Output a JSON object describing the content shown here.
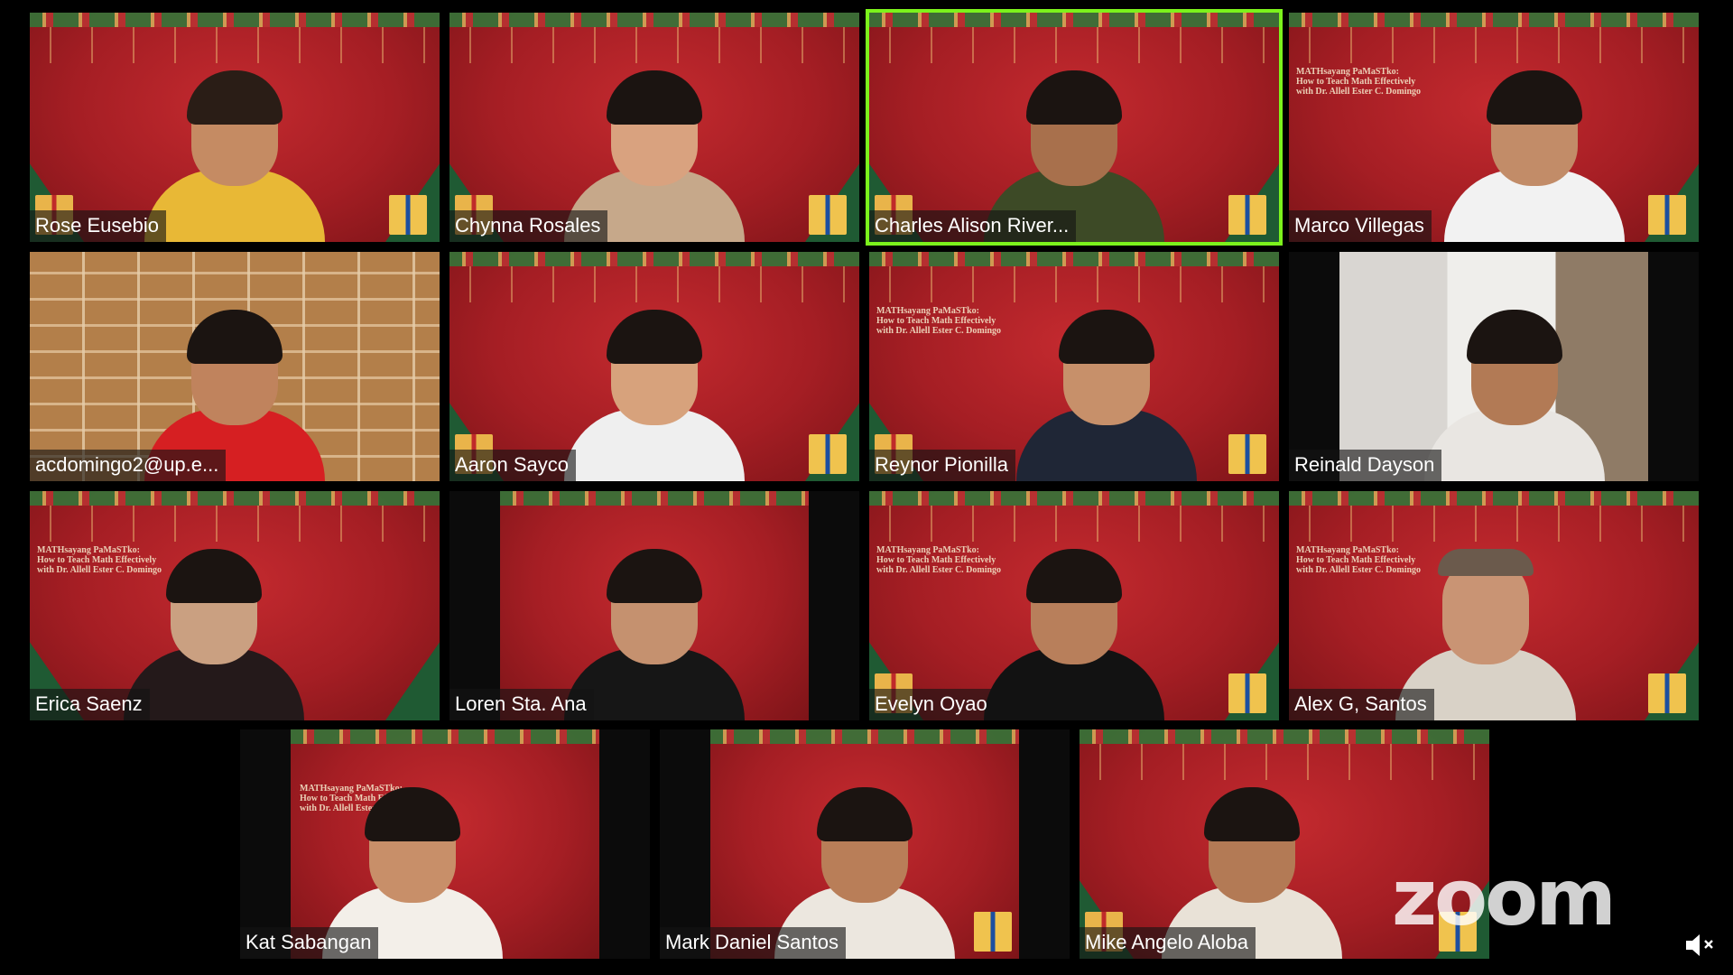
{
  "window": {
    "watermark": "zoom"
  },
  "title_card": {
    "line1": "MATHsayang PaMaSTko:",
    "line2": "How to Teach Math Effectively",
    "line3": "with Dr. Allell Ester C. Domingo"
  },
  "participants": [
    {
      "name": "Rose Eusebio",
      "bg": "xmas"
    },
    {
      "name": "Chynna Rosales",
      "bg": "xmas"
    },
    {
      "name": "Charles Alison River...",
      "bg": "xmas",
      "active_speaker": true
    },
    {
      "name": "Marco Villegas",
      "bg": "xmas"
    },
    {
      "name": "acdomingo2@up.e...",
      "bg": "brick"
    },
    {
      "name": "Aaron Sayco",
      "bg": "xmas"
    },
    {
      "name": "Reynor Pionilla",
      "bg": "xmas"
    },
    {
      "name": "Reinald Dayson",
      "bg": "room"
    },
    {
      "name": "Erica Saenz",
      "bg": "xmas"
    },
    {
      "name": "Loren Sta. Ana",
      "bg": "xmas"
    },
    {
      "name": "Evelyn Oyao",
      "bg": "xmas"
    },
    {
      "name": "Alex G, Santos",
      "bg": "xmas"
    },
    {
      "name": "Kat Sabangan",
      "bg": "xmas"
    },
    {
      "name": "Mark Daniel Santos",
      "bg": "xmas"
    },
    {
      "name": "Mike Angelo Aloba",
      "bg": "xmas"
    }
  ],
  "icons": {
    "audio": "speaker-muted-icon"
  },
  "colors": {
    "active_border": "#7cf21c",
    "background_red": "#a51e24"
  }
}
